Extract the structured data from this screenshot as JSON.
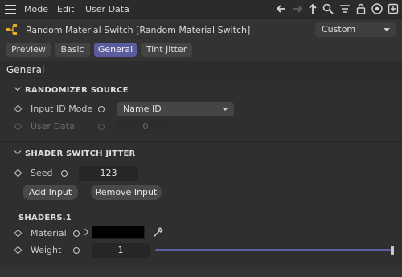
{
  "menubar": {
    "items": [
      "Mode",
      "Edit",
      "User Data"
    ],
    "icons": [
      "back-arrow-icon",
      "forward-arrow-icon",
      "up-arrow-icon",
      "search-icon",
      "filter-icon",
      "lock-icon",
      "target-icon",
      "new-window-icon"
    ]
  },
  "object": {
    "title": "Random Material Switch [Random Material Switch]",
    "preset": "Custom"
  },
  "tabs": [
    {
      "label": "Preview",
      "active": false
    },
    {
      "label": "Basic",
      "active": false
    },
    {
      "label": "General",
      "active": true
    },
    {
      "label": "Tint Jitter",
      "active": false
    }
  ],
  "section": {
    "title": "General"
  },
  "randomizer": {
    "heading": "RANDOMIZER SOURCE",
    "input_id_mode": {
      "label": "Input ID Mode",
      "value": "Name ID"
    },
    "user_data": {
      "label": "User Data",
      "value": "0"
    }
  },
  "jitter": {
    "heading": "SHADER SWITCH JITTER",
    "seed": {
      "label": "Seed",
      "value": "123"
    },
    "add_input": "Add Input",
    "remove_input": "Remove Input"
  },
  "shaders": {
    "heading": "SHADERS.1",
    "material": {
      "label": "Material",
      "swatch": "#000000"
    },
    "weight": {
      "label": "Weight",
      "value": "1",
      "fraction": 1.0
    }
  },
  "colors": {
    "accent": "#5a5c9e",
    "slider": "#5e5fa5"
  }
}
